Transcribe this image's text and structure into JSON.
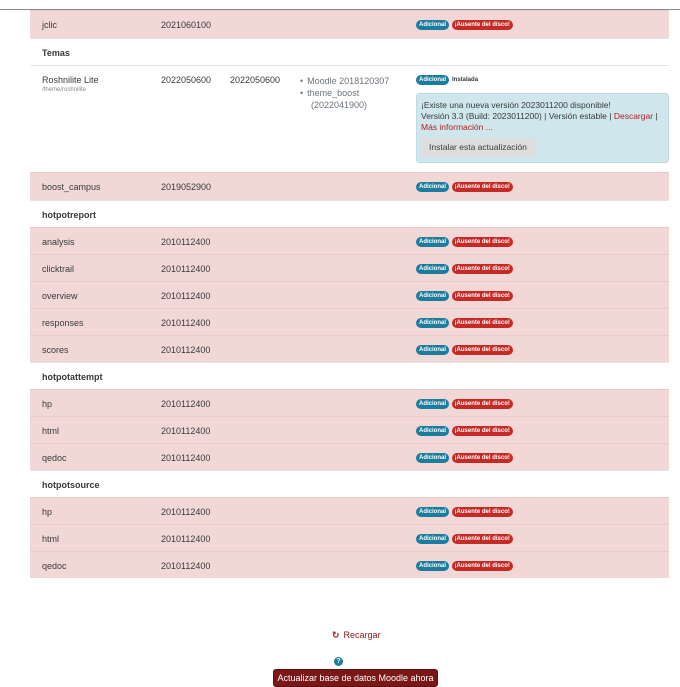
{
  "labels": {
    "adicional": "Adicional",
    "ausente": "¡Ausente del disco!",
    "instalada": "Instalada"
  },
  "rows": {
    "jclic": {
      "name": "jclic",
      "version": "2021060100"
    },
    "temas_header": "Temas",
    "roshnilite": {
      "name": "Roshnilite Lite",
      "path": "/theme/roshnilite",
      "version": "2022050600",
      "version_disk": "2022050600",
      "deps": [
        "Moodle 2018120307",
        "theme_boost",
        "(2022041900)"
      ],
      "update": {
        "line1": "¡Existe una nueva versión 2023011200 disponible!",
        "line2": "Versión 3.3 (Build: 2023011200) | Versión estable |",
        "download": "Descargar",
        "sep": "|",
        "more": "Más información ...",
        "install_button": "Instalar esta actualización"
      }
    },
    "boost_campus": {
      "name": "boost_campus",
      "version": "2019052900"
    },
    "hotpotreport_header": "hotpotreport",
    "hotpotreport": [
      {
        "name": "analysis",
        "version": "2010112400"
      },
      {
        "name": "clicktrail",
        "version": "2010112400"
      },
      {
        "name": "overview",
        "version": "2010112400"
      },
      {
        "name": "responses",
        "version": "2010112400"
      },
      {
        "name": "scores",
        "version": "2010112400"
      }
    ],
    "hotpotattempt_header": "hotpotattempt",
    "hotpotattempt": [
      {
        "name": "hp",
        "version": "2010112400"
      },
      {
        "name": "html",
        "version": "2010112400"
      },
      {
        "name": "qedoc",
        "version": "2010112400"
      }
    ],
    "hotpotsource_header": "hotpotsource",
    "hotpotsource": [
      {
        "name": "hp",
        "version": "2010112400"
      },
      {
        "name": "html",
        "version": "2010112400"
      },
      {
        "name": "qedoc",
        "version": "2010112400"
      }
    ]
  },
  "footer": {
    "reload": "Recargar",
    "help_icon": "question-icon",
    "update_db_button": "Actualizar base de datos Moodle ahora"
  },
  "colors": {
    "missing_row": "#f2d7d7",
    "info_badge": "#1b7c9e",
    "danger_badge": "#c52a26",
    "primary": "#7a1818"
  }
}
